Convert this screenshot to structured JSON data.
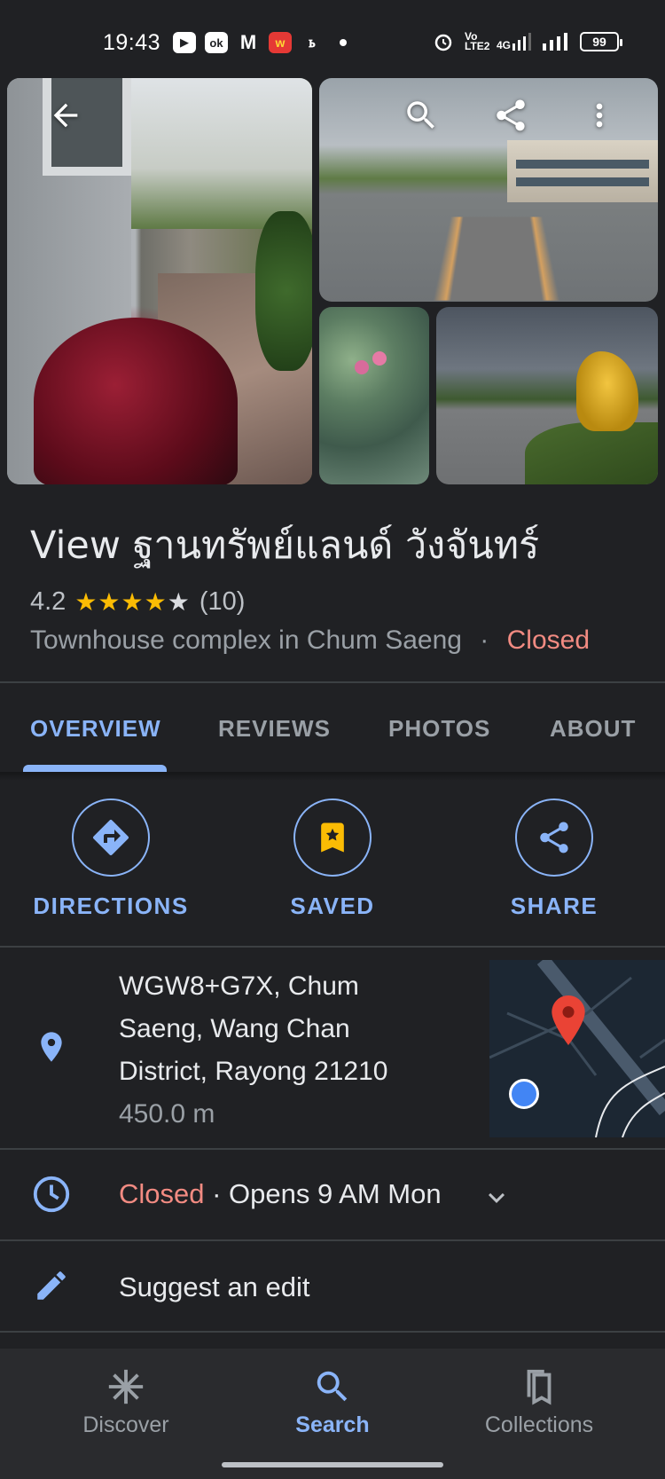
{
  "status_bar": {
    "time": "19:43",
    "notification_icons": [
      "camera-app-icon",
      "ok-app-icon",
      "gmail-icon",
      "wb-app-icon",
      "tt-app-icon"
    ],
    "network_volte": "Vo LTE2",
    "network_4g": "4G",
    "battery": "99"
  },
  "photos": {
    "back_icon": "arrow-back-icon",
    "search_icon": "search-icon",
    "share_icon": "share-icon",
    "more_icon": "more-vert-icon"
  },
  "place": {
    "title": "View ฐานทรัพย์แลนด์ วังจันทร์",
    "rating": "4.2",
    "stars": {
      "full": 4,
      "empty": 1
    },
    "review_count": "(10)",
    "category": "Townhouse complex in Chum Saeng",
    "separator": "·",
    "status": "Closed"
  },
  "tabs": [
    {
      "label": "OVERVIEW",
      "active": true
    },
    {
      "label": "REVIEWS",
      "active": false
    },
    {
      "label": "PHOTOS",
      "active": false
    },
    {
      "label": "ABOUT",
      "active": false
    }
  ],
  "actions": [
    {
      "label": "DIRECTIONS",
      "icon": "directions-icon"
    },
    {
      "label": "SAVED",
      "icon": "bookmark-saved-icon"
    },
    {
      "label": "SHARE",
      "icon": "share-icon"
    }
  ],
  "address": {
    "line1": "WGW8+G7X, Chum",
    "line2": "Saeng, Wang Chan",
    "line3": "District, Rayong 21210",
    "distance": "450.0 m"
  },
  "hours": {
    "status": "Closed",
    "detail": " · Opens 9 AM Mon"
  },
  "suggest_edit": "Suggest an edit",
  "bottom_nav": [
    {
      "label": "Discover",
      "icon": "discover-icon",
      "active": false
    },
    {
      "label": "Search",
      "icon": "search-icon",
      "active": true
    },
    {
      "label": "Collections",
      "icon": "collections-icon",
      "active": false
    }
  ],
  "colors": {
    "background": "#202124",
    "accent": "#8ab4f8",
    "closed": "#f28b82",
    "star": "#fbbc04",
    "map_pin": "#ea4335"
  }
}
